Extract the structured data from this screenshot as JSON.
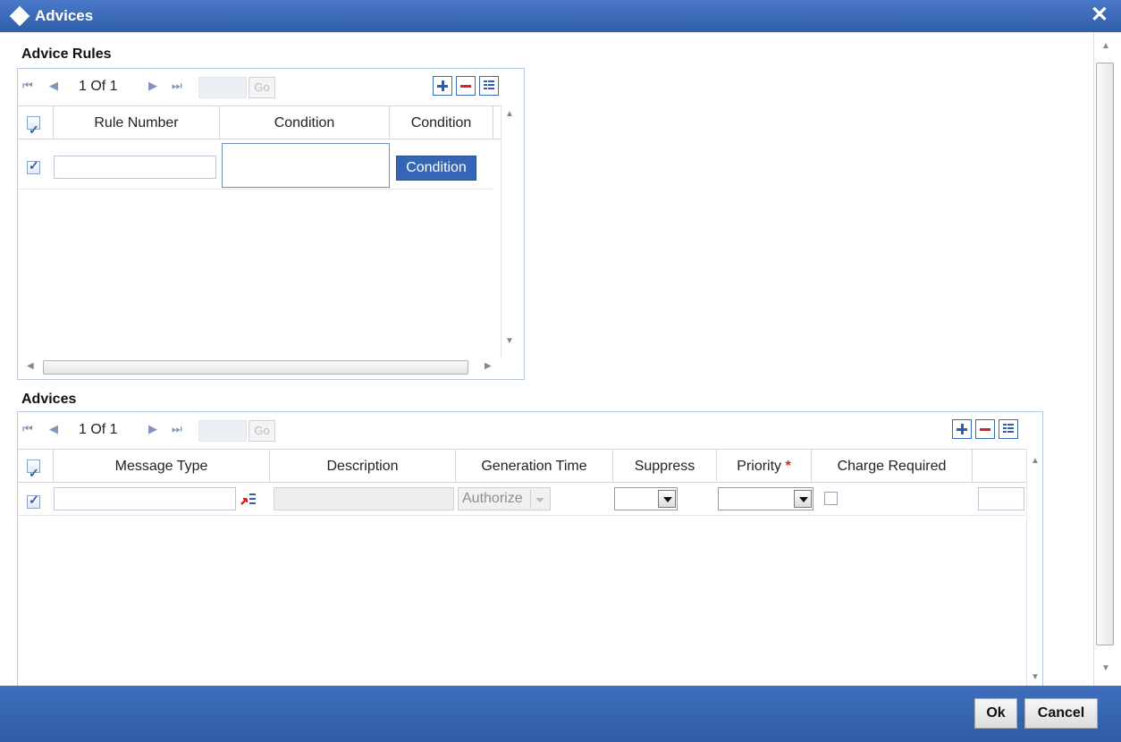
{
  "window": {
    "title": "Advices",
    "close_icon": "close-icon"
  },
  "advice_rules": {
    "section_title": "Advice Rules",
    "pager": {
      "first": "⏮",
      "prev": "◀",
      "page_info": "1 Of 1",
      "next": "▶",
      "last": "⏭",
      "go_label": "Go"
    },
    "toolbar": {
      "add": "plus-icon",
      "remove": "minus-icon",
      "view": "list-icon"
    },
    "columns": [
      "Rule Number",
      "Condition",
      "Condition"
    ],
    "rows": [
      {
        "checked": true,
        "rule_number": "",
        "condition": "",
        "condition_button": "Condition"
      }
    ]
  },
  "advices": {
    "section_title": "Advices",
    "pager": {
      "first": "⏮",
      "prev": "◀",
      "page_info": "1 Of 1",
      "next": "▶",
      "last": "⏭",
      "go_label": "Go"
    },
    "toolbar": {
      "add": "plus-icon",
      "remove": "minus-icon",
      "view": "list-icon"
    },
    "columns": [
      "Message Type",
      "Description",
      "Generation Time",
      "Suppress",
      "Priority",
      "Charge Required"
    ],
    "required_mark": "*",
    "rows": [
      {
        "checked": true,
        "message_type": "",
        "description": "",
        "generation_time": "Authorize",
        "suppress": "",
        "priority": "",
        "charge_required": false
      }
    ]
  },
  "footer": {
    "ok_label": "Ok",
    "cancel_label": "Cancel"
  },
  "colors": {
    "header_blue": "#2f5ea8",
    "accent_red": "#d8232a",
    "button_blue": "#3566b6"
  }
}
